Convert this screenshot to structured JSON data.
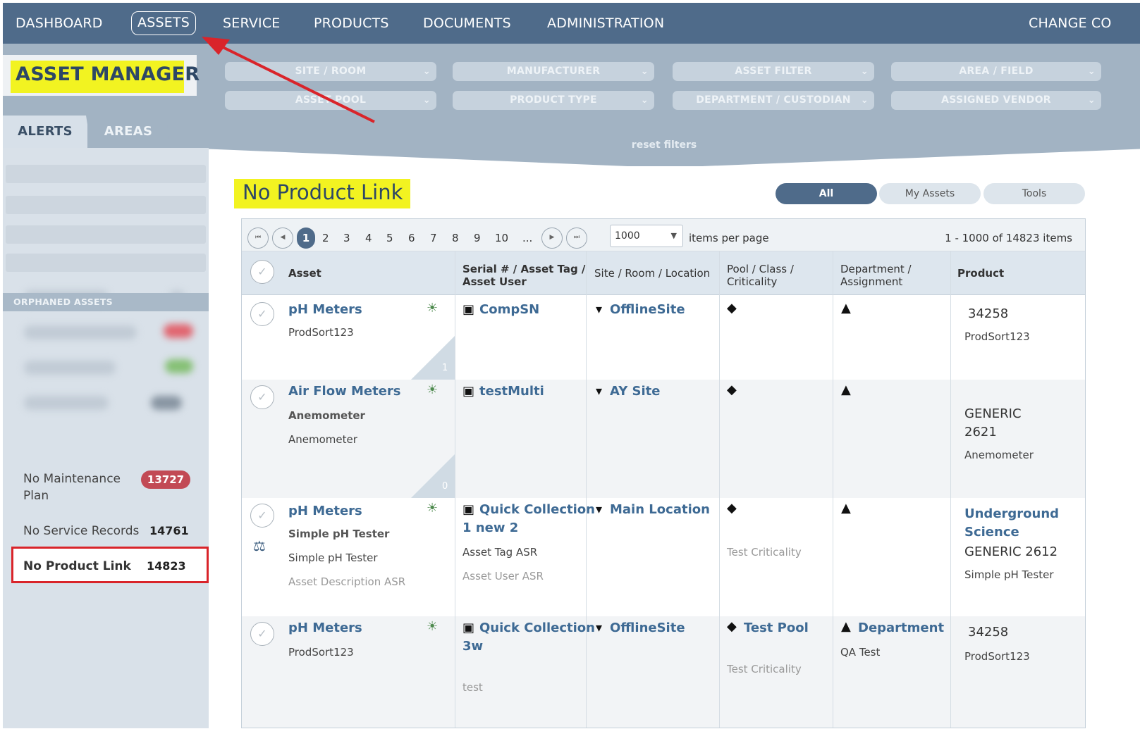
{
  "nav": {
    "items": [
      "DASHBOARD",
      "ASSETS",
      "SERVICE",
      "PRODUCTS",
      "DOCUMENTS",
      "ADMINISTRATION"
    ],
    "active": "ASSETS",
    "right_label": "CHANGE CO"
  },
  "app_title": "ASSET MANAGER",
  "filters": {
    "site_room": "SITE / ROOM",
    "manufacturer": "MANUFACTURER",
    "asset_filter": "ASSET FILTER",
    "area_field": "AREA / FIELD",
    "asset_pool": "ASSET POOL",
    "product_type": "PRODUCT TYPE",
    "department_custodian": "DEPARTMENT / CUSTODIAN",
    "assigned_vendor": "ASSIGNED VENDOR",
    "reset": "reset filters"
  },
  "tabs": {
    "alerts": "ALERTS",
    "areas": "AREAS"
  },
  "sidebar": {
    "section": "ORPHANED ASSETS",
    "no_maintenance_1": "No Maintenance",
    "no_maintenance_2": "Plan",
    "no_maintenance_count": "13727",
    "no_service": "No Service Records",
    "no_service_count": "14761",
    "no_product": "No Product Link",
    "no_product_count": "14823"
  },
  "page_title": "No Product Link",
  "segments": {
    "all": "All",
    "my": "My Assets",
    "tools": "Tools"
  },
  "pager": {
    "pages": [
      "1",
      "2",
      "3",
      "4",
      "5",
      "6",
      "7",
      "8",
      "9",
      "10",
      "..."
    ],
    "current": "1",
    "page_size": "1000",
    "items_per_page": "items per page",
    "count_text": "1 - 1000 of 14823 items"
  },
  "columns": {
    "asset": "Asset",
    "serial_1": "Serial # / Asset Tag /",
    "serial_2": "Asset User",
    "site": "Site / Room / Location",
    "pool_1": "Pool / Class /",
    "pool_2": "Criticality",
    "dept_1": "Department /",
    "dept_2": "Assignment",
    "product": "Product"
  },
  "rows": [
    {
      "asset": "pH Meters",
      "asset_sub1": "ProdSort123",
      "corner": "1",
      "serial": "CompSN",
      "site": "OfflineSite",
      "prod1": "34258",
      "prod2": "ProdSort123"
    },
    {
      "asset": "Air Flow Meters",
      "asset_sub1": "Anemometer",
      "asset_sub2": "Anemometer",
      "corner": "0",
      "serial": "testMulti",
      "site": "AY Site",
      "prod1": "GENERIC",
      "prod2": "2621",
      "prod3": "Anemometer"
    },
    {
      "asset": "pH Meters",
      "asset_sub1": "Simple pH Tester",
      "asset_sub2": "Simple pH Tester",
      "asset_sub3": "Asset Description ASR",
      "serial_1": "Quick Collection",
      "serial_2": "1 new 2",
      "tag": "Asset Tag ASR",
      "user": "Asset User ASR",
      "site": "Main Location",
      "criticality": "Test Criticality",
      "prod_link1": "Underground",
      "prod_link2": "Science",
      "prod1": "GENERIC 2612",
      "prod2": "Simple pH Tester"
    },
    {
      "asset": "pH Meters",
      "asset_sub1": "ProdSort123",
      "serial_1": "Quick Collection",
      "serial_2": "3w",
      "user": "test",
      "site": "OfflineSite",
      "pool": "Test Pool",
      "criticality": "Test Criticality",
      "dept": "Department",
      "dept_sub": "QA Test",
      "prod1": "34258",
      "prod2": "ProdSort123"
    }
  ],
  "colors": {
    "nav_bg": "#4f6b8a",
    "filter_bg": "#a2b3c3",
    "highlight": "#f2f321",
    "badge_red": "#c24a55",
    "link": "#3e6a94",
    "annotation_red": "#d9242a"
  },
  "icons": [
    "lightbulb-icon",
    "cube-icon",
    "map-pin-icon",
    "tag-icon",
    "person-icon",
    "balance-scale-icon",
    "check-icon",
    "chevron-down-icon"
  ]
}
